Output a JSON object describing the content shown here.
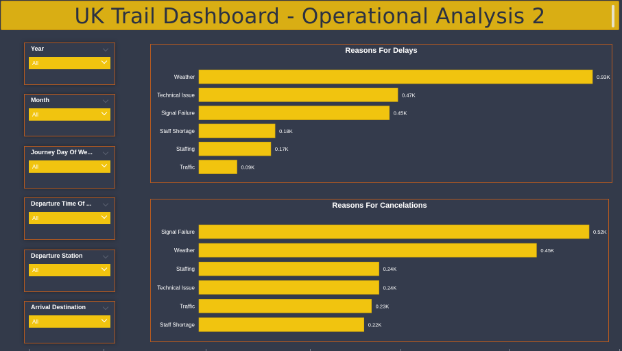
{
  "header": {
    "title": "UK Trail Dashboard - Operational Analysis 2"
  },
  "slicers": [
    {
      "label": "Year",
      "value": "All"
    },
    {
      "label": "Month",
      "value": "All"
    },
    {
      "label": "Journey Day Of We...",
      "value": "All"
    },
    {
      "label": "Departure Time Of ...",
      "value": "All"
    },
    {
      "label": "Departure Station",
      "value": "All"
    },
    {
      "label": "Arrival Destination",
      "value": "All"
    }
  ],
  "colors": {
    "bar": "#f1c40f",
    "bar_border": "#d4a90a",
    "panel_border": "#b75a1f",
    "background": "#333a4a",
    "header": "#d9ae14"
  },
  "chart_data": [
    {
      "type": "bar",
      "orientation": "horizontal",
      "title": "Reasons For Delays",
      "categories": [
        "Weather",
        "Technical Issue",
        "Signal Failure",
        "Staff Shortage",
        "Staffing",
        "Traffic"
      ],
      "values": [
        930,
        470,
        450,
        180,
        170,
        90
      ],
      "value_labels": [
        "0.93K",
        "0.47K",
        "0.45K",
        "0.18K",
        "0.17K",
        "0.09K"
      ],
      "xlim": [
        0,
        930
      ]
    },
    {
      "type": "bar",
      "orientation": "horizontal",
      "title": "Reasons For Cancelations",
      "categories": [
        "Signal Failure",
        "Weather",
        "Staffing",
        "Technical Issue",
        "Traffic",
        "Staff Shortage"
      ],
      "values": [
        520,
        450,
        240,
        240,
        230,
        220
      ],
      "value_labels": [
        "0.52K",
        "0.45K",
        "0.24K",
        "0.24K",
        "0.23K",
        "0.22K"
      ],
      "xlim": [
        0,
        520
      ]
    }
  ]
}
